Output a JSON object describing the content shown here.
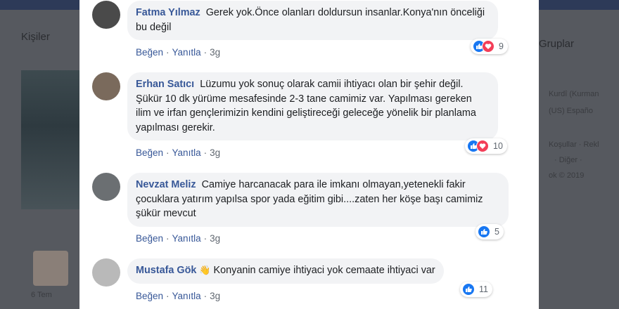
{
  "background": {
    "left_title": "Kişiler",
    "right_title": "Gruplar",
    "lang_line1": "Kurdî (Kurman",
    "lang_line2": "(US)   Españo",
    "footer_line1": "Koşullar · Rekl",
    "footer_line2": "· Diğer ·",
    "footer_line3": "ok © 2019",
    "date_snippet": "6 Tem"
  },
  "labels": {
    "like": "Beğen",
    "reply": "Yanıtla",
    "separator": "·"
  },
  "comments": [
    {
      "author": "Fatma Yılmaz",
      "text": "Gerek yok.Önce olanları doldursun insanlar.Konya'nın önceliği bu değil",
      "time": "3g",
      "reactions": "9",
      "avatar_color": "#4a4a4a"
    },
    {
      "author": "Erhan Satıcı",
      "text": "Lüzumu yok sonuç olarak camii ihtiyacı olan bir şehir değil. Şükür 10 dk yürüme mesafesinde 2-3 tane camimiz var. Yapılması gereken ilim ve irfan gençlerimizin kendini geliştireceği geleceğe yönelik bir planlama yapılması gerekir.",
      "time": "3g",
      "reactions": "10",
      "avatar_color": "#7a6a5c"
    },
    {
      "author": "Nevzat Meliz",
      "text": "Camiye harcanacak para ile imkanı olmayan,yetenekli fakir çocuklara yatırım yapılsa spor yada eğitim gibi....zaten her köşe başı camimiz şükür mevcut",
      "time": "3g",
      "reactions": "5",
      "avatar_color": "#6b6f72"
    },
    {
      "author": "Mustafa Gök",
      "emoji": "👋",
      "text": "Konyanin camiye ihtiyaci yok cemaate ihtiyaci var",
      "time": "3g",
      "reactions": "11",
      "avatar_color": "#b9b9b9"
    }
  ],
  "icons": [
    "like-icon",
    "love-icon",
    "waving-hand-icon"
  ],
  "colors": {
    "link": "#385898",
    "bubble": "#f2f3f5",
    "like": "#1877f2",
    "love": "#f33e58"
  }
}
